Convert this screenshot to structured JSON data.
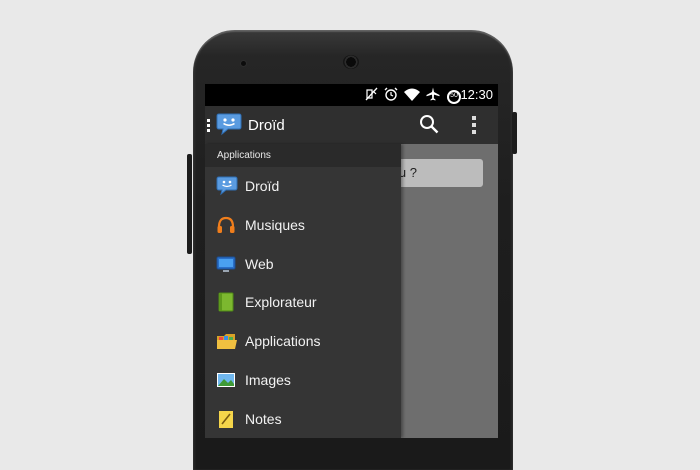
{
  "status_bar": {
    "icons": [
      "mute-icon",
      "alarm-icon",
      "wifi-icon",
      "airplane-icon",
      "battery-icon"
    ],
    "battery_level": "50",
    "time": "12:30"
  },
  "action_bar": {
    "title": "Droïd",
    "icons": [
      "drawer-indicator-icon",
      "droid-app-icon",
      "search-icon",
      "overflow-menu-icon"
    ]
  },
  "content": {
    "visible_text": "eux-tu ?"
  },
  "drawer": {
    "section_title": "Applications",
    "items": [
      {
        "label": "Droïd",
        "icon": "droid-icon"
      },
      {
        "label": "Musiques",
        "icon": "headphones-icon"
      },
      {
        "label": "Web",
        "icon": "monitor-icon"
      },
      {
        "label": "Explorateur",
        "icon": "book-icon"
      },
      {
        "label": "Applications",
        "icon": "folder-icon"
      },
      {
        "label": "Images",
        "icon": "image-icon"
      },
      {
        "label": "Notes",
        "icon": "notepad-icon"
      }
    ]
  },
  "colors": {
    "status_bar": "#000000",
    "action_bar": "#2f2f2f",
    "drawer": "#353535",
    "accent_blue": "#4a90d9"
  }
}
